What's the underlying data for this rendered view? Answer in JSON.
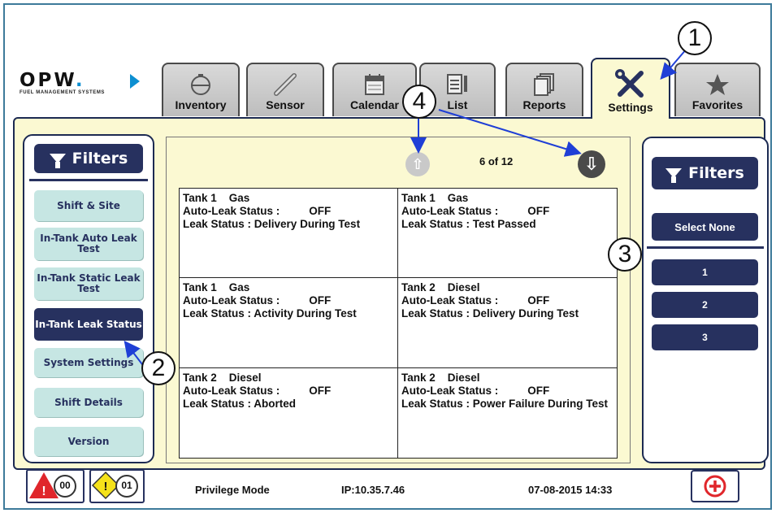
{
  "brand": {
    "name": "OPW",
    "dot": ".",
    "tagline": "FUEL MANAGEMENT SYSTEMS"
  },
  "tabs": [
    {
      "label": "Inventory",
      "icon": "tank-icon"
    },
    {
      "label": "Sensor",
      "icon": "probe-icon"
    },
    {
      "label": "Calendar",
      "icon": "calendar-icon"
    },
    {
      "label": "List",
      "icon": "list-icon"
    },
    {
      "label": "Reports",
      "icon": "reports-icon"
    },
    {
      "label": "Settings",
      "icon": "wrench-screwdriver-icon",
      "active": true
    },
    {
      "label": "Favorites",
      "icon": "star-icon"
    }
  ],
  "left_panel": {
    "filters_label": "Filters",
    "items": [
      {
        "label": "Shift & Site"
      },
      {
        "label": "In-Tank Auto Leak Test"
      },
      {
        "label": "In-Tank Static Leak Test"
      },
      {
        "label": "In-Tank Leak Status",
        "selected": true
      },
      {
        "label": "System Settings"
      },
      {
        "label": "Shift Details"
      },
      {
        "label": "Version"
      }
    ]
  },
  "pager": {
    "text": "6 of 12"
  },
  "tanks": [
    {
      "name": "Tank 1",
      "product": "Gas",
      "auto_leak_label": "Auto-Leak Status :",
      "auto_leak_value": "OFF",
      "leak_status": "Leak Status : Delivery During Test"
    },
    {
      "name": "Tank 1",
      "product": "Gas",
      "auto_leak_label": "Auto-Leak Status :",
      "auto_leak_value": "OFF",
      "leak_status": "Leak Status : Test Passed"
    },
    {
      "name": "Tank 1",
      "product": "Gas",
      "auto_leak_label": "Auto-Leak Status :",
      "auto_leak_value": "OFF",
      "leak_status": "Leak Status : Activity During Test"
    },
    {
      "name": "Tank 2",
      "product": "Diesel",
      "auto_leak_label": "Auto-Leak Status :",
      "auto_leak_value": "OFF",
      "leak_status": "Leak Status : Delivery During Test"
    },
    {
      "name": "Tank 2",
      "product": "Diesel",
      "auto_leak_label": "Auto-Leak Status :",
      "auto_leak_value": "OFF",
      "leak_status": "Leak Status : Aborted"
    },
    {
      "name": "Tank 2",
      "product": "Diesel",
      "auto_leak_label": "Auto-Leak Status :",
      "auto_leak_value": "OFF",
      "leak_status": "Leak Status : Power Failure During Test"
    }
  ],
  "right_panel": {
    "filters_label": "Filters",
    "select_none_label": "Select None",
    "items": [
      "1",
      "2",
      "3"
    ]
  },
  "status": {
    "alarm_count": "00",
    "warning_count": "01",
    "mode": "Privilege Mode",
    "ip": "IP:10.35.7.46",
    "datetime": "07-08-2015 14:33"
  },
  "callouts": [
    "1",
    "2",
    "3",
    "4"
  ],
  "colors": {
    "accent": "#27315f",
    "panel_bg": "#fbf9d2",
    "button_bg": "#c6e6e3",
    "arrow": "#1f3fd6",
    "alarm_red": "#e0262b",
    "warning_yellow": "#f5e21a"
  }
}
